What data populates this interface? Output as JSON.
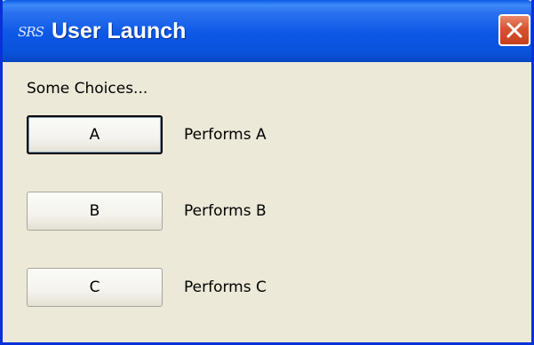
{
  "window": {
    "title": "User Launch",
    "icon_text": "SRS",
    "icon": "srs-app-icon",
    "close_icon": "close-icon"
  },
  "dialog": {
    "heading": "Some Choices...",
    "choices": [
      {
        "label": "A",
        "description": "Performs A",
        "is_default": true
      },
      {
        "label": "B",
        "description": "Performs B",
        "is_default": false
      },
      {
        "label": "C",
        "description": "Performs C",
        "is_default": false
      }
    ]
  },
  "colors": {
    "titlebar": "#0a5ce8",
    "window_frame": "#0831d9",
    "client_area": "#ece9d8",
    "close_button": "#d7532f"
  }
}
